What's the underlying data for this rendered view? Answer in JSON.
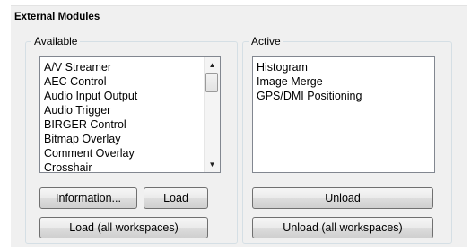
{
  "panel": {
    "title": "External Modules"
  },
  "available": {
    "label": "Available",
    "items": [
      "A/V Streamer",
      "AEC Control",
      "Audio Input Output",
      "Audio Trigger",
      "BIRGER Control",
      "Bitmap Overlay",
      "Comment Overlay",
      "Crosshair"
    ],
    "information_button": "Information...",
    "load_button": "Load",
    "load_all_button": "Load (all workspaces)"
  },
  "active": {
    "label": "Active",
    "items": [
      "Histogram",
      "Image Merge",
      "GPS/DMI Positioning"
    ],
    "unload_button": "Unload",
    "unload_all_button": "Unload (all workspaces)"
  },
  "icons": {
    "scroll_up": "▲",
    "scroll_down": "▼"
  }
}
